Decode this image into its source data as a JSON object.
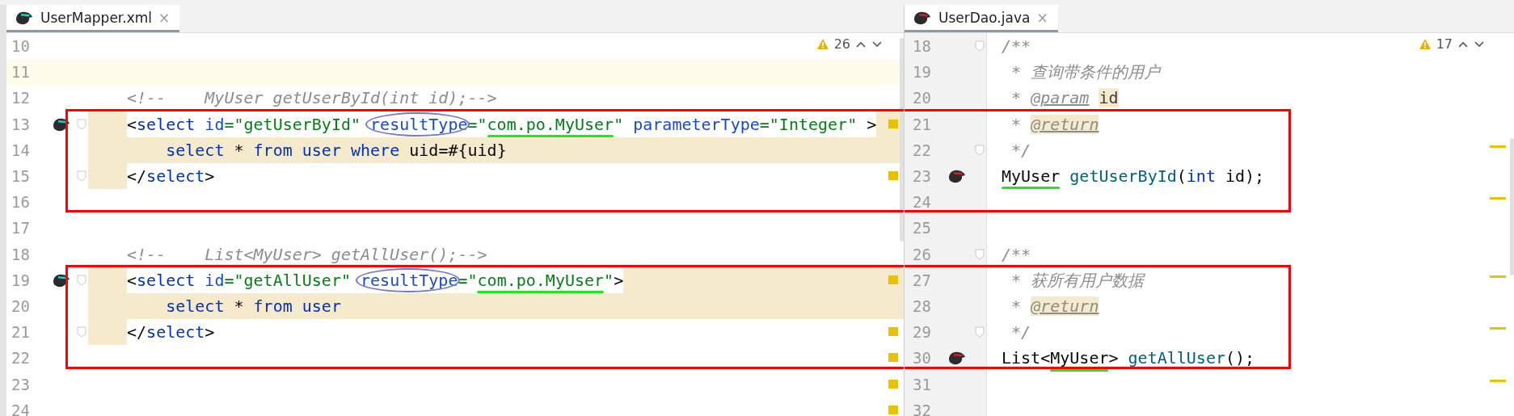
{
  "panes": [
    {
      "tab": {
        "name": "UserMapper.xml",
        "close": "×",
        "selected": true
      },
      "warnings": "26",
      "lines": [
        {
          "number": "10"
        },
        {
          "number": "11",
          "current": true
        },
        {
          "number": "12",
          "tokens": [
            {
              "text": "<!--    MyUser getUserById(int id);-->",
              "kind": "comment"
            }
          ]
        },
        {
          "number": "13",
          "kind": "tail_highlighted",
          "gutter_icon": true,
          "fold": true,
          "boxed": true,
          "marker": true,
          "tokens": [
            {
              "text": "<",
              "kind": "plain"
            },
            {
              "text": "select",
              "kind": "tag"
            },
            {
              "text": " id",
              "kind": "attr"
            },
            {
              "text": "=\"getUserById\"",
              "kind": "value"
            },
            {
              "text": " resultType",
              "kind": "attr",
              "circled": true
            },
            {
              "text": "=\"",
              "kind": "value"
            },
            {
              "text": "com.po.MyUser",
              "kind": "value",
              "underlined": true
            },
            {
              "text": "\"",
              "kind": "value"
            },
            {
              "text": " parameterType",
              "kind": "attr"
            },
            {
              "text": "=\"Integer\"",
              "kind": "value"
            },
            {
              "text": " >",
              "kind": "plain"
            }
          ]
        },
        {
          "number": "14",
          "kind": "highlighted",
          "boxed": true,
          "tokens": [
            {
              "text": "    select",
              "kind": "keyword"
            },
            {
              "text": " * ",
              "kind": "plain"
            },
            {
              "text": "from",
              "kind": "keyword"
            },
            {
              "text": " user",
              "kind": "keyword"
            },
            {
              "text": " where",
              "kind": "keyword"
            },
            {
              "text": " uid=#{uid}",
              "kind": "plain"
            }
          ]
        },
        {
          "number": "15",
          "kind": "indent_highlighted",
          "fold": true,
          "boxed": true,
          "marker": true,
          "tokens": [
            {
              "text": "</",
              "kind": "plain"
            },
            {
              "text": "select",
              "kind": "tag"
            },
            {
              "text": ">",
              "kind": "plain"
            }
          ]
        },
        {
          "number": "16",
          "boxed": true
        },
        {
          "number": "17"
        },
        {
          "number": "18",
          "tokens": [
            {
              "text": "<!--    List<MyUser> getAllUser();-->",
              "kind": "comment"
            }
          ]
        },
        {
          "number": "19",
          "kind": "tail_highlighted",
          "gutter_icon": true,
          "fold": true,
          "boxed": true,
          "marker": true,
          "tokens": [
            {
              "text": "<",
              "kind": "plain"
            },
            {
              "text": "select",
              "kind": "tag"
            },
            {
              "text": " id",
              "kind": "attr"
            },
            {
              "text": "=\"getAllUser\"",
              "kind": "value"
            },
            {
              "text": " resultType",
              "kind": "attr",
              "circled": true
            },
            {
              "text": "=\"",
              "kind": "value"
            },
            {
              "text": "com.po.MyUser",
              "kind": "value",
              "underlined": true
            },
            {
              "text": "\"",
              "kind": "value"
            },
            {
              "text": ">",
              "kind": "plain"
            }
          ]
        },
        {
          "number": "20",
          "kind": "highlighted",
          "boxed": true,
          "tokens": [
            {
              "text": "    select",
              "kind": "keyword"
            },
            {
              "text": " * ",
              "kind": "plain"
            },
            {
              "text": "from",
              "kind": "keyword"
            },
            {
              "text": " user",
              "kind": "keyword"
            }
          ]
        },
        {
          "number": "21",
          "kind": "indent_highlighted",
          "fold": true,
          "boxed": true,
          "marker": true,
          "tokens": [
            {
              "text": "</",
              "kind": "plain"
            },
            {
              "text": "select",
              "kind": "tag"
            },
            {
              "text": ">",
              "kind": "plain"
            }
          ]
        },
        {
          "number": "22",
          "boxed": true,
          "marker": true
        },
        {
          "number": "23",
          "marker": true
        },
        {
          "number": "24",
          "marker": true
        }
      ]
    },
    {
      "tab": {
        "name": "UserDao.java",
        "close": "×",
        "selected": true
      },
      "warnings": "17",
      "lines": [
        {
          "number": "18",
          "fold": true,
          "tokens": [
            {
              "text": "/**",
              "kind": "doc"
            }
          ]
        },
        {
          "number": "19",
          "tokens": [
            {
              "text": " * 查询带条件的用户",
              "kind": "doc"
            }
          ]
        },
        {
          "number": "20",
          "tokens": [
            {
              "text": " * ",
              "kind": "doc"
            },
            {
              "text": "@param",
              "kind": "doctag"
            },
            {
              "text": " id",
              "kind": "param_marked"
            }
          ]
        },
        {
          "number": "21",
          "boxed": true,
          "tokens": [
            {
              "text": " * ",
              "kind": "doc"
            },
            {
              "text": "@return",
              "kind": "doctag_marked"
            }
          ]
        },
        {
          "number": "22",
          "fold": true,
          "boxed": true,
          "marker": true,
          "tokens": [
            {
              "text": " */",
              "kind": "doc"
            }
          ]
        },
        {
          "number": "23",
          "gutter_icon": true,
          "boxed": true,
          "tokens": [
            {
              "text": "MyUser",
              "kind": "plain",
              "underlined": true
            },
            {
              "text": " getUserById",
              "kind": "method"
            },
            {
              "text": "(",
              "kind": "plain"
            },
            {
              "text": "int",
              "kind": "keyword"
            },
            {
              "text": " id);",
              "kind": "plain"
            }
          ]
        },
        {
          "number": "24",
          "boxed": true,
          "marker": true
        },
        {
          "number": "25"
        },
        {
          "number": "26",
          "fold": true,
          "tokens": [
            {
              "text": "/**",
              "kind": "doc"
            }
          ]
        },
        {
          "number": "27",
          "boxed": true,
          "marker": true,
          "tokens": [
            {
              "text": " * 获所有用户数据",
              "kind": "doc"
            }
          ]
        },
        {
          "number": "28",
          "boxed": true,
          "tokens": [
            {
              "text": " * ",
              "kind": "doc"
            },
            {
              "text": "@return",
              "kind": "doctag_marked"
            }
          ]
        },
        {
          "number": "29",
          "fold": true,
          "boxed": true,
          "marker": true,
          "tokens": [
            {
              "text": " */",
              "kind": "doc"
            }
          ]
        },
        {
          "number": "30",
          "gutter_icon": true,
          "boxed": true,
          "tokens": [
            {
              "text": "List<",
              "kind": "plain"
            },
            {
              "text": "MyUser",
              "kind": "plain",
              "underlined": true
            },
            {
              "text": ">",
              "kind": "plain"
            },
            {
              "text": " getAllUser",
              "kind": "method"
            },
            {
              "text": "();",
              "kind": "plain"
            }
          ]
        },
        {
          "number": "31",
          "marker": true
        },
        {
          "number": "32"
        }
      ]
    }
  ]
}
